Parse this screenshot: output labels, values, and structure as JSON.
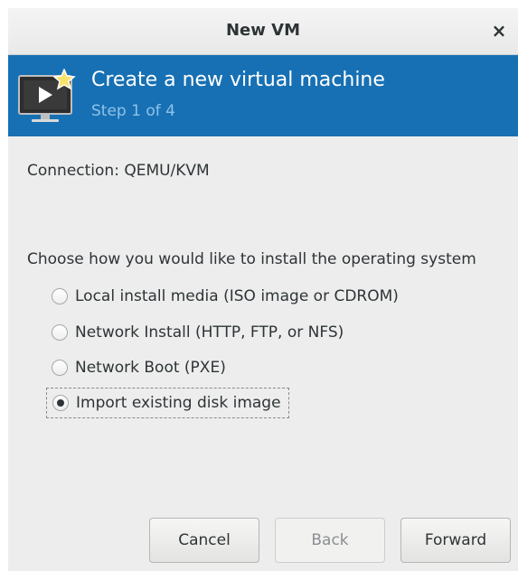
{
  "window": {
    "title": "New VM",
    "close_glyph": "×"
  },
  "banner": {
    "title": "Create a new virtual machine",
    "step": "Step 1 of 4",
    "icon": "monitor-play-star-icon",
    "background_color": "#1770b3"
  },
  "connection": {
    "text": "Connection:  QEMU/KVM"
  },
  "install": {
    "prompt": "Choose how you would like to install the operating system",
    "options": [
      {
        "label": "Local install media (ISO image or CDROM)",
        "checked": false
      },
      {
        "label": "Network Install (HTTP, FTP, or NFS)",
        "checked": false
      },
      {
        "label": "Network Boot (PXE)",
        "checked": false
      },
      {
        "label": "Import existing disk image",
        "checked": true
      }
    ]
  },
  "buttons": {
    "cancel": "Cancel",
    "back": "Back",
    "forward": "Forward"
  }
}
